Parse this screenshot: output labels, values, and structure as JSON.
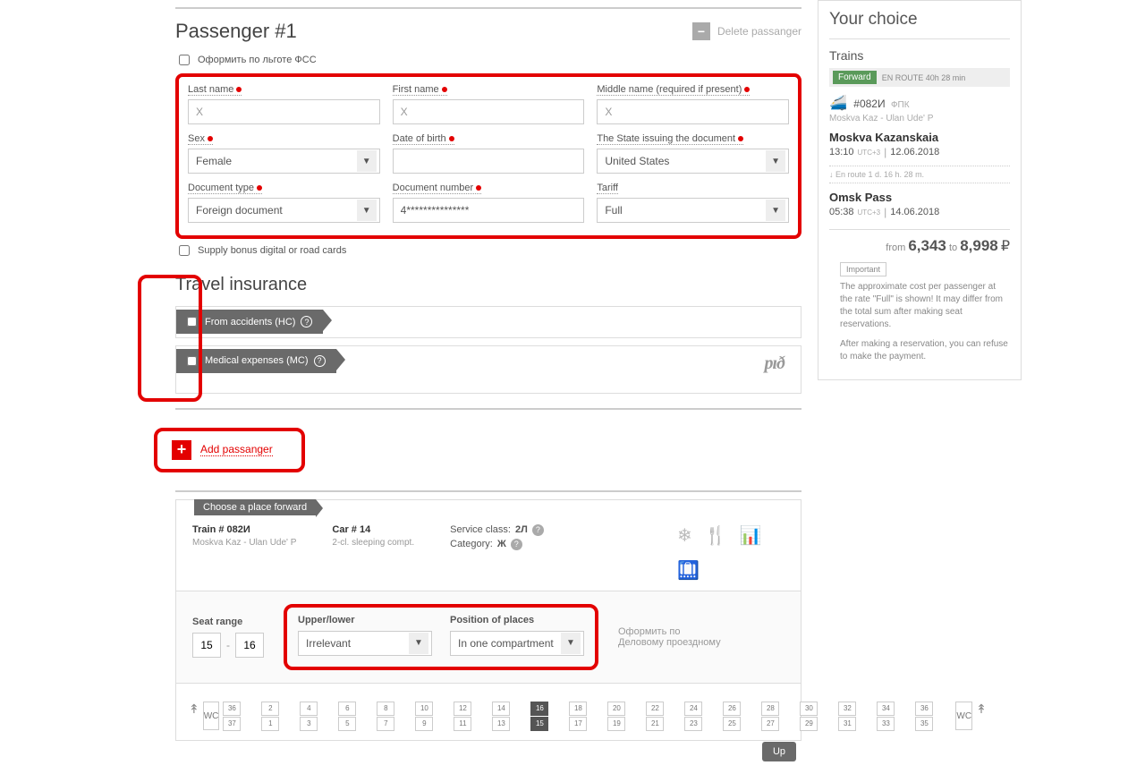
{
  "passenger": {
    "title": "Passenger #1",
    "delete_label": "Delete passanger",
    "fss_label": "Оформить по льготе ФСС",
    "fields": {
      "last_name": {
        "label": "Last name",
        "placeholder": "X"
      },
      "first_name": {
        "label": "First name",
        "placeholder": "X"
      },
      "middle_name": {
        "label": "Middle name (required if present)",
        "placeholder": "X"
      },
      "sex": {
        "label": "Sex",
        "value": "Female"
      },
      "dob": {
        "label": "Date of birth",
        "value": ""
      },
      "state": {
        "label": "The State issuing the document",
        "value": "United States"
      },
      "doc_type": {
        "label": "Document type",
        "value": "Foreign document"
      },
      "doc_number": {
        "label": "Document number",
        "value": "4***************"
      },
      "tariff": {
        "label": "Tariff",
        "value": "Full"
      }
    },
    "bonus_label": "Supply bonus digital or road cards"
  },
  "insurance": {
    "title": "Travel insurance",
    "opt1": "From accidents (HC)",
    "opt2": "Medical expenses (MC)",
    "rzd": "pıð"
  },
  "add_passenger": "Add passanger",
  "place": {
    "tab": "Choose a place forward",
    "train": "Train # 082И",
    "route": "Moskva Kaz - Ulan Ude' P",
    "car": "Car # 14",
    "car_sub": "2-cl. sleeping compt.",
    "service_class_label": "Service class:",
    "service_class": "2Л",
    "category_label": "Category:",
    "category": "Ж",
    "seat_range_label": "Seat range",
    "seat_from": "15",
    "seat_to": "16",
    "upper_lower_label": "Upper/lower",
    "upper_lower": "Irrelevant",
    "position_label": "Position of places",
    "position": "In one compartment",
    "biz_text": "Оформить по Деловому проездному",
    "seats": [
      [
        "36",
        "2",
        "4",
        "6",
        "8",
        "10",
        "12",
        "14",
        "16",
        "18",
        "20",
        "22",
        "24",
        "26",
        "28",
        "30",
        "32",
        "34",
        "36"
      ],
      [
        "37",
        "1",
        "3",
        "5",
        "7",
        "9",
        "11",
        "13",
        "15",
        "17",
        "19",
        "21",
        "23",
        "25",
        "27",
        "29",
        "31",
        "33",
        "35"
      ]
    ]
  },
  "choice": {
    "title": "Your choice",
    "trains": "Trains",
    "forward": "Forward",
    "en_route_badge": "EN ROUTE 40h 28 min",
    "train_num": "#082И",
    "train_co": "ФПК",
    "route_line": "Moskva Kaz - Ulan Ude' P",
    "dep_station": "Moskva Kazanskaia",
    "dep_time": "13:10",
    "dep_tz": "UTC+3",
    "dep_date": "12.06.2018",
    "enroute": "↓ En route  1 d. 16 h. 28 m.",
    "arr_station": "Omsk Pass",
    "arr_time": "05:38",
    "arr_tz": "UTC+3",
    "arr_date": "14.06.2018",
    "from_label": "from",
    "price1": "6,343",
    "to_label": "to",
    "price2": "8,998",
    "important": "Important",
    "note1": "The approximate cost per passenger at the rate \"Full\" is shown! It may differ from the total sum after making seat reservations.",
    "note2": "After making a reservation, you can refuse to make the payment."
  },
  "up": "Up"
}
